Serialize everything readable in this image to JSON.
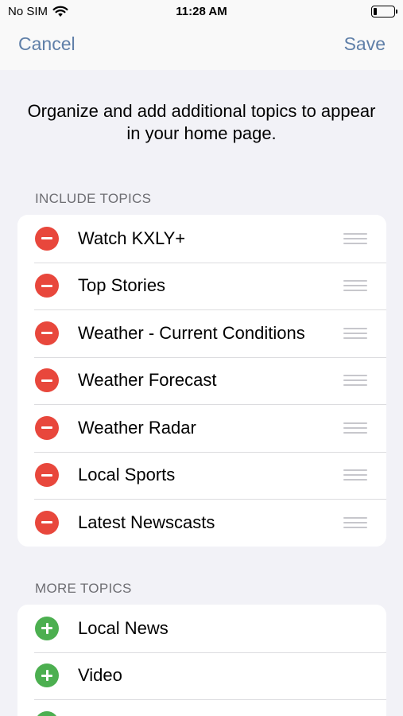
{
  "status_bar": {
    "carrier": "No SIM",
    "time": "11:28 AM",
    "wifi_icon": "wifi-icon",
    "battery_icon": "battery-icon"
  },
  "nav": {
    "cancel_label": "Cancel",
    "save_label": "Save"
  },
  "intro_text": "Organize and add additional topics to appear in your home page.",
  "include_section": {
    "header": "INCLUDE TOPICS",
    "items": [
      {
        "label": "Watch KXLY+"
      },
      {
        "label": "Top Stories"
      },
      {
        "label": "Weather - Current Conditions"
      },
      {
        "label": "Weather Forecast"
      },
      {
        "label": "Weather Radar"
      },
      {
        "label": "Local Sports"
      },
      {
        "label": "Latest Newscasts"
      }
    ]
  },
  "more_section": {
    "header": "MORE TOPICS",
    "items": [
      {
        "label": "Local News"
      },
      {
        "label": "Video"
      },
      {
        "label": ""
      }
    ]
  },
  "colors": {
    "accent": "#5f7fa8",
    "remove": "#e8473c",
    "add": "#4caf50",
    "background": "#f2f2f7"
  }
}
